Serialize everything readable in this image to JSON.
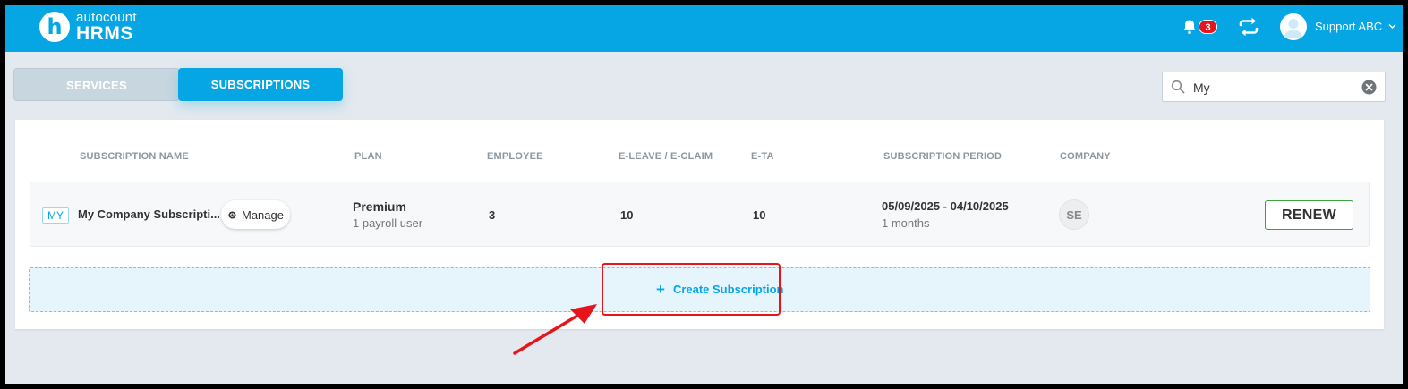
{
  "header": {
    "logo_top": "autocount",
    "logo_bottom": "HRMS",
    "logo_letter": "h",
    "notification_count": "3",
    "user_name": "Support ABC",
    "icons": [
      "bell-icon",
      "sync-icon",
      "avatar",
      "chevron-down-icon"
    ]
  },
  "tabs": [
    {
      "label": "SERVICES",
      "active": false
    },
    {
      "label": "SUBSCRIPTIONS",
      "active": true
    }
  ],
  "search": {
    "value": "My"
  },
  "table": {
    "columns": [
      "SUBSCRIPTION NAME",
      "PLAN",
      "EMPLOYEE",
      "E-LEAVE / E-CLAIM",
      "E-TA",
      "SUBSCRIPTION PERIOD",
      "COMPANY"
    ],
    "rows": [
      {
        "country": "MY",
        "name": "My Company Subscripti...",
        "manage_label": "Manage",
        "plan": "Premium",
        "plan_detail": "1 payroll user",
        "employee": "3",
        "eleave_eclaim": "10",
        "eta": "10",
        "period": "05/09/2025 - 04/10/2025",
        "period_detail": "1 months",
        "company": "SE",
        "action_label": "RENEW"
      }
    ]
  },
  "create": {
    "plus": "+",
    "label": "Create Subscription"
  },
  "colors": {
    "brand": "#05a6e3",
    "renew_border": "#3aa243",
    "annotation": "#e8141c"
  }
}
